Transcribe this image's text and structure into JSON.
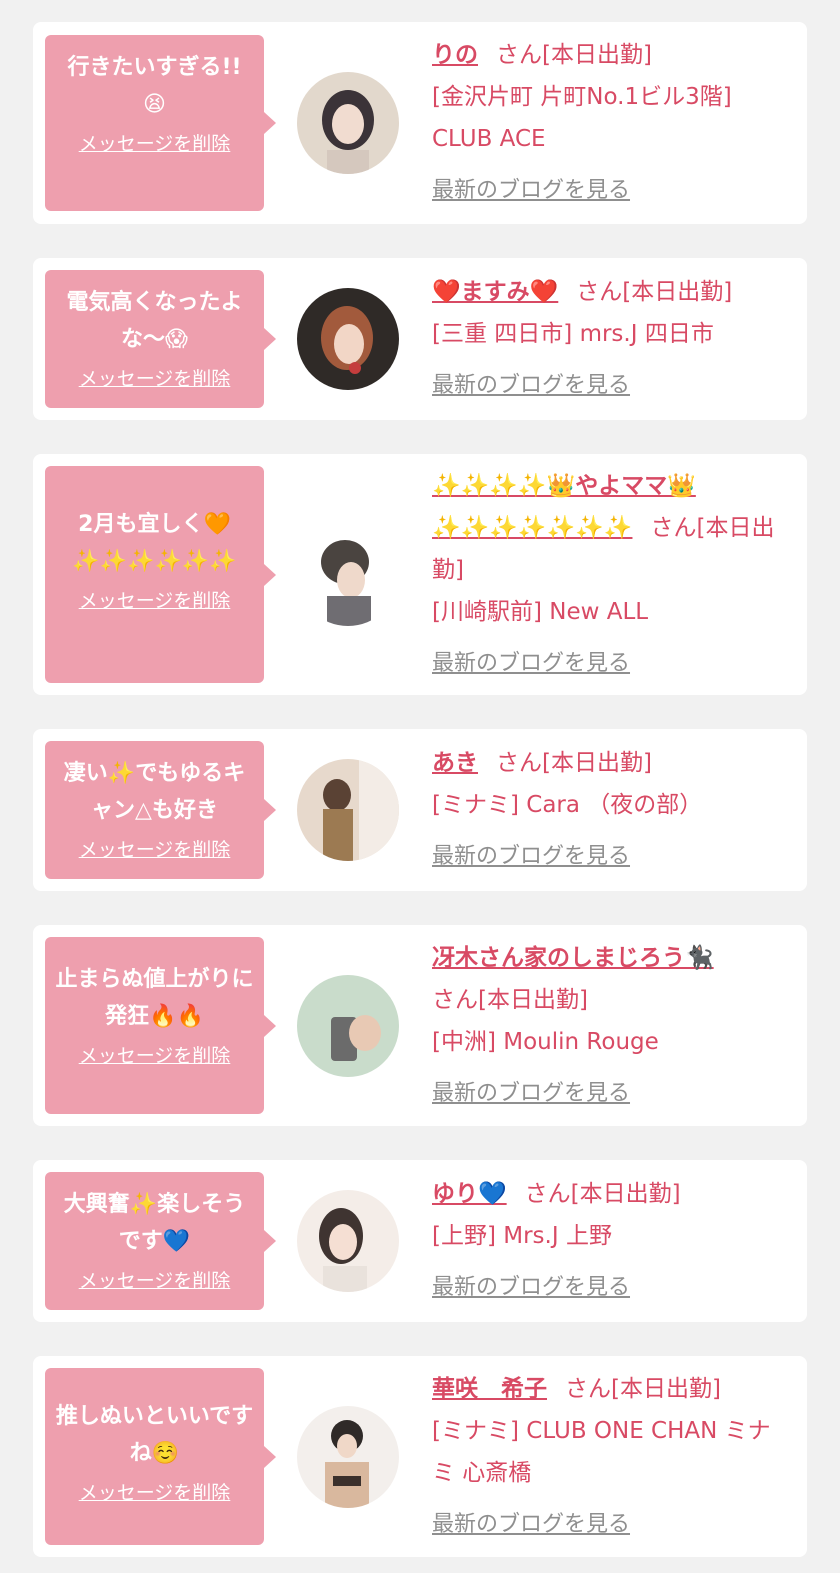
{
  "colors": {
    "background": "#f1f1f1",
    "card": "#ffffff",
    "bubble": "#ee9fae",
    "accent": "#d84a64",
    "muted": "#8f8f8f"
  },
  "entries": [
    {
      "bubble_text": "行きたいすぎる!!",
      "bubble_emoji": "😫",
      "delete_label": "メッセージを削除",
      "name": "りの",
      "status": "さん[本日出勤]",
      "shop": "[金沢片町 片町No.1ビル3階] CLUB ACE",
      "blog_link": "最新のブログを見る",
      "avatar": "woman-portrait-1"
    },
    {
      "bubble_text": "電気高くなったよな〜",
      "bubble_emoji": "😱",
      "delete_label": "メッセージを削除",
      "name": "❤️ますみ❤️",
      "status": "さん[本日出勤]",
      "shop": "[三重 四日市] mrs.J 四日市",
      "blog_link": "最新のブログを見る",
      "avatar": "woman-portrait-2"
    },
    {
      "bubble_text": "2月も宜しく🧡",
      "bubble_emoji": "✨✨✨✨✨✨",
      "delete_label": "メッセージを削除",
      "name": "✨✨✨✨👑やよママ👑✨✨✨✨✨✨✨",
      "status": "さん[本日出勤]",
      "shop": "[川崎駅前] New ALL",
      "blog_link": "最新のブログを見る",
      "avatar": "woman-portrait-3"
    },
    {
      "bubble_text": "凄い✨でもゆるキャン△も好き",
      "bubble_emoji": "",
      "delete_label": "メッセージを削除",
      "name": "あき",
      "status": "さん[本日出勤]",
      "shop": "[ミナミ] Cara （夜の部）",
      "blog_link": "最新のブログを見る",
      "avatar": "woman-portrait-4"
    },
    {
      "bubble_text": "止まらぬ値上がりに発狂🔥🔥",
      "bubble_emoji": "",
      "delete_label": "メッセージを削除",
      "name": "冴木さん家のしまじろう🐈‍⬛",
      "status": "さん[本日出勤]",
      "shop": "[中洲] Moulin Rouge",
      "blog_link": "最新のブログを見る",
      "avatar": "woman-portrait-5"
    },
    {
      "bubble_text": "大興奮✨楽しそうです💙",
      "bubble_emoji": "",
      "delete_label": "メッセージを削除",
      "name": "ゆり💙",
      "status": "さん[本日出勤]",
      "shop": "[上野] Mrs.J 上野",
      "blog_link": "最新のブログを見る",
      "avatar": "woman-portrait-6"
    },
    {
      "bubble_text": "推しぬいといいですね☺️",
      "bubble_emoji": "",
      "delete_label": "メッセージを削除",
      "name": "華咲　希子",
      "status": "さん[本日出勤]",
      "shop": "[ミナミ] CLUB ONE CHAN ミナミ 心斎橋",
      "blog_link": "最新のブログを見る",
      "avatar": "woman-portrait-7"
    }
  ]
}
